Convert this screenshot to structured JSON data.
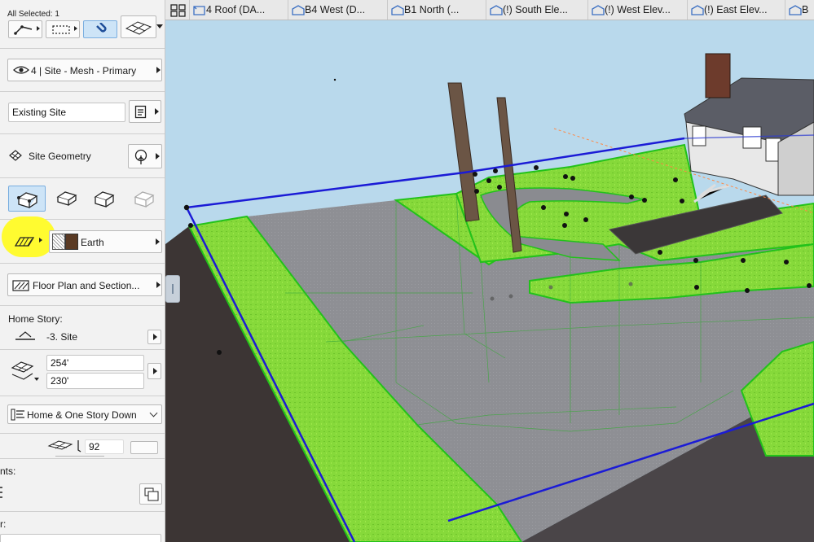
{
  "panel": {
    "selection_text": "All Selected: 1",
    "layer": "4 | Site - Mesh - Primary",
    "element_id": "Existing Site",
    "geometry_label": "Site Geometry",
    "surface_label": "Earth",
    "floor_plan_label": "Floor Plan and Section...",
    "home_story_heading": "Home Story:",
    "home_story_value": "-3. Site",
    "height_top": "254'",
    "height_bottom": "230'",
    "show_on_stories": "Home & One Story Down",
    "ridges_value": "92",
    "points_label": "nts:",
    "bottom_label": "r:"
  },
  "tabs": [
    {
      "label": "4 Roof (DA...",
      "icon": "floorplan-icon"
    },
    {
      "label": "B4 West (D...",
      "icon": "elevation-icon"
    },
    {
      "label": "B1 North  (...",
      "icon": "elevation-icon"
    },
    {
      "label": "(!) South Ele...",
      "icon": "elevation-icon"
    },
    {
      "label": "(!) West Elev...",
      "icon": "elevation-icon"
    },
    {
      "label": "(!) East Elev...",
      "icon": "elevation-icon"
    },
    {
      "label": "B",
      "icon": "elevation-icon"
    }
  ],
  "colors": {
    "sky": "#b9d9ec",
    "grass": "#86d93a",
    "grass_edge": "#22c21a",
    "pavement": "#8e8f94",
    "selection_line": "#1b1bd6",
    "highlight": "#ffff3c"
  }
}
